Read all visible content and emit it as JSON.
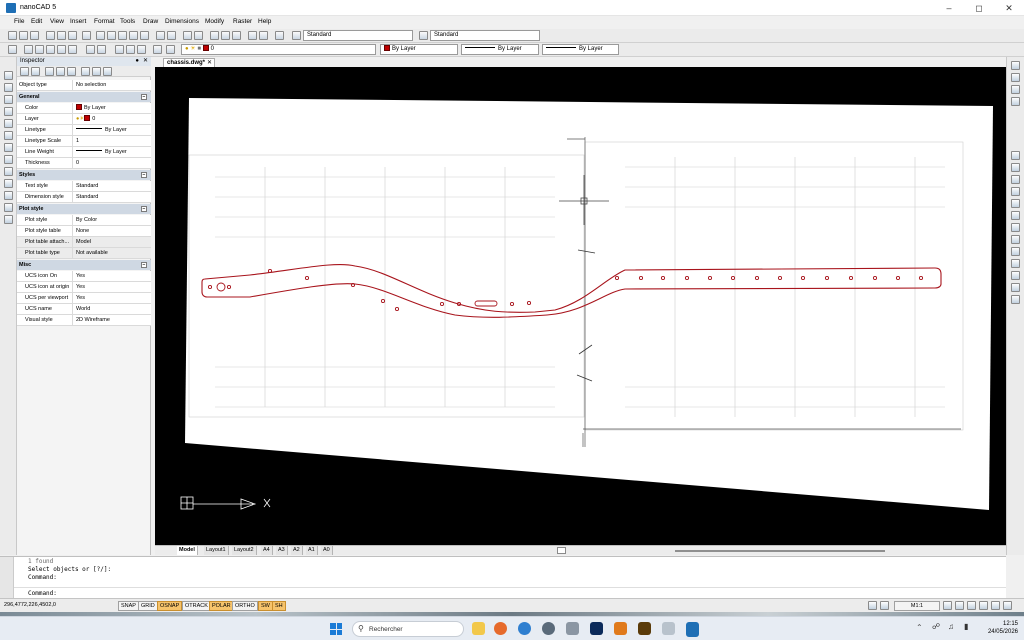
{
  "window": {
    "title": "nanoCAD 5",
    "colors": {
      "accent": "#1f6fb5",
      "drawing_red": "#a8141c"
    }
  },
  "menu": [
    "File",
    "Edit",
    "View",
    "Insert",
    "Format",
    "Tools",
    "Draw",
    "Dimensions",
    "Modify",
    "Raster",
    "Help"
  ],
  "toolbar": {
    "text_style": "Standard",
    "dim_style": "Standard",
    "layer": "0",
    "color": "By Layer",
    "linetype": "By Layer",
    "lineweight": "By Layer"
  },
  "inspector": {
    "title": "Inspector",
    "object_type_label": "Object type",
    "object_type_value": "No selection",
    "sections": {
      "general": "General",
      "styles": "Styles",
      "plot": "Plot style",
      "misc": "Misc"
    },
    "general": [
      {
        "label": "Color",
        "value": "By Layer"
      },
      {
        "label": "Layer",
        "value": "0"
      },
      {
        "label": "Linetype",
        "value": "By Layer"
      },
      {
        "label": "Linetype Scale",
        "value": "1"
      },
      {
        "label": "Line Weight",
        "value": "By Layer"
      },
      {
        "label": "Thickness",
        "value": "0"
      }
    ],
    "styles": [
      {
        "label": "Text style",
        "value": "Standard"
      },
      {
        "label": "Dimension style",
        "value": "Standard"
      }
    ],
    "plot": [
      {
        "label": "Plot style",
        "value": "By Color"
      },
      {
        "label": "Plot style table",
        "value": "None"
      },
      {
        "label": "Plot table attach...",
        "value": "Model"
      },
      {
        "label": "Plot table type",
        "value": "Not available"
      }
    ],
    "misc": [
      {
        "label": "UCS icon On",
        "value": "Yes"
      },
      {
        "label": "UCS icon at origin",
        "value": "Yes"
      },
      {
        "label": "UCS per viewport",
        "value": "Yes"
      },
      {
        "label": "UCS name",
        "value": "World"
      },
      {
        "label": "Visual style",
        "value": "2D Wireframe"
      }
    ]
  },
  "document": {
    "tab": "chassis.dwg*"
  },
  "layout_tabs": [
    "Model",
    "Layout1",
    "Layout2",
    "A4",
    "A3",
    "A2",
    "A1",
    "A0"
  ],
  "command": {
    "lines": [
      "1 found",
      "Select objects or [?/]:",
      "Command:"
    ],
    "prompt": "Command:"
  },
  "status": {
    "coords": "296,4772,226,4502,0",
    "buttons": [
      {
        "label": "SNAP",
        "on": false
      },
      {
        "label": "GRID",
        "on": false
      },
      {
        "label": "OSNAP",
        "on": true
      },
      {
        "label": "OTRACK",
        "on": false
      },
      {
        "label": "POLAR",
        "on": true
      },
      {
        "label": "ORTHO",
        "on": false
      },
      {
        "label": "SW",
        "on": true
      },
      {
        "label": "SH",
        "on": true
      }
    ],
    "scale": "M1:1"
  },
  "taskbar": {
    "search": "Rechercher",
    "time": "12:15",
    "date": "24/05/2026"
  }
}
